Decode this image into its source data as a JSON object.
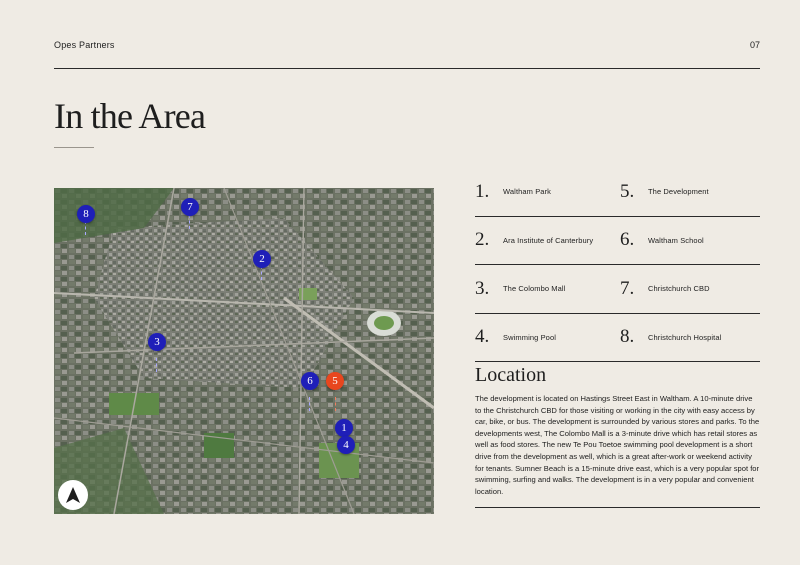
{
  "header": {
    "brand": "Opes Partners",
    "page_number": "07"
  },
  "title": "In the Area",
  "map": {
    "pins": [
      {
        "label": "8",
        "color": "#1f1fb8"
      },
      {
        "label": "7",
        "color": "#1f1fb8"
      },
      {
        "label": "2",
        "color": "#1f1fb8"
      },
      {
        "label": "3",
        "color": "#1f1fb8"
      },
      {
        "label": "6",
        "color": "#1f1fb8"
      },
      {
        "label": "5",
        "color": "#e8461e"
      },
      {
        "label": "1",
        "color": "#1f1fb8"
      },
      {
        "label": "4",
        "color": "#1f1fb8"
      }
    ],
    "compass_icon": "north-arrow-icon"
  },
  "places": [
    {
      "num": "1.",
      "name": "Waltham Park"
    },
    {
      "num": "5.",
      "name": "The Development"
    },
    {
      "num": "2.",
      "name": "Ara Institute of Canterbury"
    },
    {
      "num": "6.",
      "name": "Waltham School"
    },
    {
      "num": "3.",
      "name": "The Colombo Mall"
    },
    {
      "num": "7.",
      "name": "Christchurch CBD"
    },
    {
      "num": "4.",
      "name": "Swimming Pool"
    },
    {
      "num": "8.",
      "name": "Christchurch Hospital"
    }
  ],
  "location": {
    "title": "Location",
    "text": "The development is located on Hastings Street East in Waltham. A 10-minute drive to the Christchurch CBD for those visiting or working in the city with easy access by car, bike, or bus. The development is surrounded by various stores and parks. To the developments west, The Colombo Mall is a 3-minute drive which has retail stores as well as food stores. The new Te Pou Toetoe swimming pool development is a short drive from the development as well, which is a great after-work or weekend activity for tenants. Sumner Beach is a 15-minute drive east, which is a very popular spot for swimming, surfing and walks. The development is in a very popular and convenient location."
  }
}
